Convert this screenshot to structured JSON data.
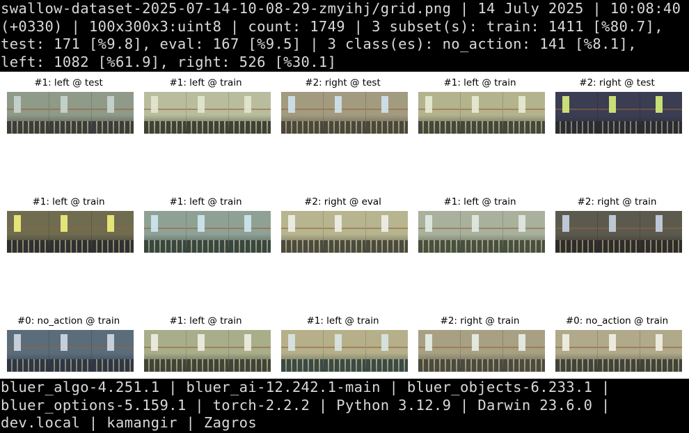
{
  "header": {
    "text": "swallow-dataset-2025-07-14-10-08-29-zmyihj/grid.png | 14 July 2025 | 10:08:40 (+0330) | 100x300x3:uint8 | count: 1749 | 3 subset(s): train: 1411 [%80.7], test: 171 [%9.8], eval: 167 [%9.5] | 3 class(es): no_action: 141 [%8.1], left: 1082 [%61.9], right: 526 [%30.1]"
  },
  "grid": {
    "cells": [
      {
        "title": "#1: left @ test",
        "palette": {
          "wall": "#8f9a88",
          "floor": "#3a3d3a",
          "light": "#c9d6d0"
        }
      },
      {
        "title": "#1: left @ train",
        "palette": {
          "wall": "#b9bd9e",
          "floor": "#3e4236",
          "light": "#e3e7cf"
        }
      },
      {
        "title": "#2: right @ test",
        "palette": {
          "wall": "#a39b80",
          "floor": "#4a473b",
          "light": "#cfe3f0"
        }
      },
      {
        "title": "#1: left @ train",
        "palette": {
          "wall": "#b3b38e",
          "floor": "#44473a",
          "light": "#e7ebd3"
        }
      },
      {
        "title": "#2: right @ test",
        "palette": {
          "wall": "#3b3d52",
          "floor": "#2a2c33",
          "light": "#d8f07a"
        }
      },
      {
        "title": "#1: left @ train",
        "palette": {
          "wall": "#6f6c50",
          "floor": "#2e3030",
          "light": "#f2f27c"
        }
      },
      {
        "title": "#1: left @ train",
        "palette": {
          "wall": "#8fa195",
          "floor": "#37463f",
          "light": "#cfe7f2"
        }
      },
      {
        "title": "#2: right @ eval",
        "palette": {
          "wall": "#b7b58f",
          "floor": "#4a4b3e",
          "light": "#f0f0ea"
        }
      },
      {
        "title": "#1: left @ train",
        "palette": {
          "wall": "#a9b19c",
          "floor": "#47503f",
          "light": "#e1eae6"
        }
      },
      {
        "title": "#2: right @ train",
        "palette": {
          "wall": "#5c5a4e",
          "floor": "#2e2c2a",
          "light": "#c8d4e6"
        }
      },
      {
        "title": "#0: no_action @ train",
        "palette": {
          "wall": "#5b6c7a",
          "floor": "#2f3643",
          "light": "#d0dae6"
        }
      },
      {
        "title": "#1: left @ train",
        "palette": {
          "wall": "#a9ae8a",
          "floor": "#3f4437",
          "light": "#eeeee6"
        }
      },
      {
        "title": "#1: left @ train",
        "palette": {
          "wall": "#b6b08a",
          "floor": "#3a4a45",
          "light": "#d9e6e6"
        }
      },
      {
        "title": "#2: right @ train",
        "palette": {
          "wall": "#a7a083",
          "floor": "#4a4a3e",
          "light": "#e8efe8"
        }
      },
      {
        "title": "#0: no_action @ train",
        "palette": {
          "wall": "#b0a98a",
          "floor": "#41433a",
          "light": "#f2f2e6"
        }
      }
    ]
  },
  "footer": {
    "text": "bluer_algo-4.251.1 | bluer_ai-12.242.1-main | bluer_objects-6.233.1 | bluer_options-5.159.1 | torch-2.2.2 | Python 3.12.9 | Darwin 23.6.0 | dev.local | kamangir | Zagros"
  }
}
